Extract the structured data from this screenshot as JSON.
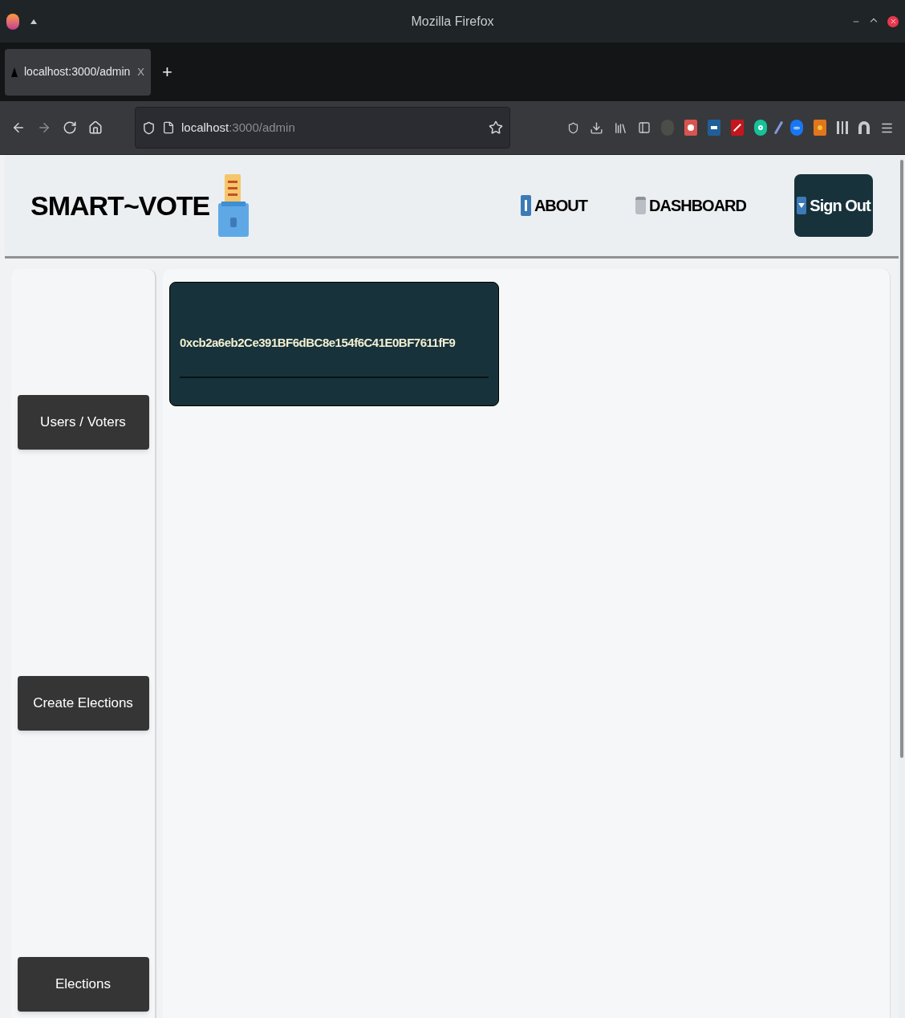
{
  "window": {
    "title": "Mozilla Firefox"
  },
  "tabs": [
    {
      "label": "localhost:3000/admin",
      "selected": true,
      "close": "X"
    }
  ],
  "new_tab": "+",
  "address_bar": {
    "host": "localhost",
    "path": ":3000/admin"
  },
  "header": {
    "brand": "SMART~VOTE",
    "nav": [
      {
        "kind": "info",
        "label": "ABOUT"
      },
      {
        "kind": "dashboard",
        "label": "DASHBOARD"
      }
    ],
    "sign_out": "Sign Out"
  },
  "account": {
    "address": "0xcb2a6eb2Ce391BF6dBC8e154f6C41E0BF7611fF9"
  },
  "sidebar": {
    "items": [
      "Users / Voters",
      "Create Elections",
      "Elections"
    ]
  }
}
